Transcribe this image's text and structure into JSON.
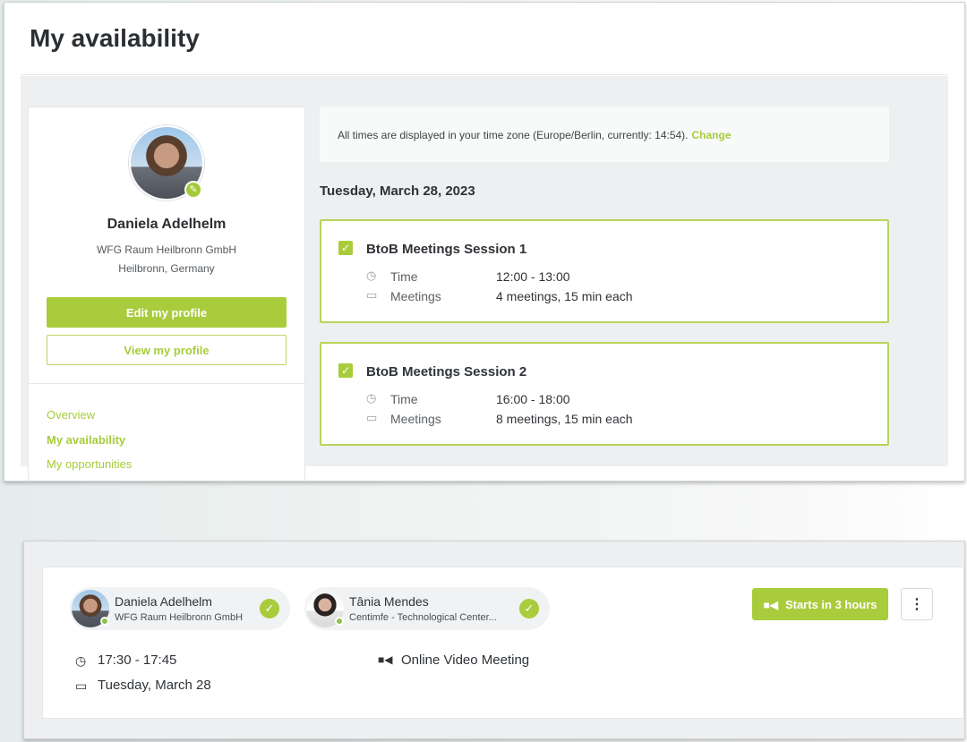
{
  "page": {
    "title": "My availability"
  },
  "profile": {
    "name": "Daniela Adelhelm",
    "company": "WFG Raum Heilbronn GmbH",
    "location": "Heilbronn, Germany",
    "edit_label": "Edit my profile",
    "view_label": "View my profile"
  },
  "nav": [
    {
      "label": "Overview",
      "active": false
    },
    {
      "label": "My availability",
      "active": true
    },
    {
      "label": "My opportunities",
      "active": false
    }
  ],
  "timezone": {
    "text": "All times are displayed in your time zone (Europe/Berlin, currently: 14:54).",
    "change_label": "Change"
  },
  "date_heading": "Tuesday, March 28, 2023",
  "sessions": [
    {
      "title": "BtoB Meetings Session 1",
      "time_label": "Time",
      "time": "12:00 - 13:00",
      "meetings_label": "Meetings",
      "meetings": "4 meetings, 15 min each"
    },
    {
      "title": "BtoB Meetings Session 2",
      "time_label": "Time",
      "time": "16:00 - 18:00",
      "meetings_label": "Meetings",
      "meetings": "8 meetings, 15 min each"
    }
  ],
  "meeting": {
    "participants": [
      {
        "name": "Daniela Adelhelm",
        "org": "WFG Raum Heilbronn GmbH"
      },
      {
        "name": "Tânia Mendes",
        "org": "Centimfe - Technological Center..."
      }
    ],
    "starts_label": "Starts in 3 hours",
    "time": "17:30 - 17:45",
    "date": "Tuesday, March 28",
    "type": "Online Video Meeting"
  },
  "colors": {
    "accent": "#a8cc3c",
    "text": "#2f3337",
    "panel_bg": "#eeeff0"
  },
  "icons": [
    "edit-icon",
    "check-icon",
    "clock-icon",
    "calendar-icon",
    "video-camera-icon",
    "more-vertical-icon"
  ]
}
